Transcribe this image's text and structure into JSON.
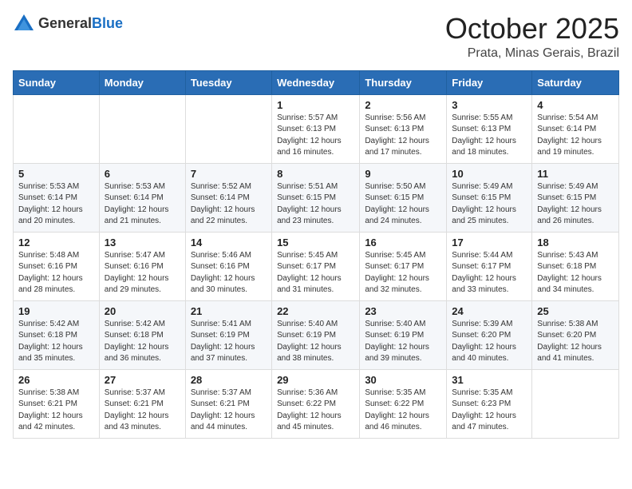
{
  "header": {
    "logo_general": "General",
    "logo_blue": "Blue",
    "month": "October 2025",
    "location": "Prata, Minas Gerais, Brazil"
  },
  "days_of_week": [
    "Sunday",
    "Monday",
    "Tuesday",
    "Wednesday",
    "Thursday",
    "Friday",
    "Saturday"
  ],
  "weeks": [
    [
      {
        "day": "",
        "info": ""
      },
      {
        "day": "",
        "info": ""
      },
      {
        "day": "",
        "info": ""
      },
      {
        "day": "1",
        "info": "Sunrise: 5:57 AM\nSunset: 6:13 PM\nDaylight: 12 hours\nand 16 minutes."
      },
      {
        "day": "2",
        "info": "Sunrise: 5:56 AM\nSunset: 6:13 PM\nDaylight: 12 hours\nand 17 minutes."
      },
      {
        "day": "3",
        "info": "Sunrise: 5:55 AM\nSunset: 6:13 PM\nDaylight: 12 hours\nand 18 minutes."
      },
      {
        "day": "4",
        "info": "Sunrise: 5:54 AM\nSunset: 6:14 PM\nDaylight: 12 hours\nand 19 minutes."
      }
    ],
    [
      {
        "day": "5",
        "info": "Sunrise: 5:53 AM\nSunset: 6:14 PM\nDaylight: 12 hours\nand 20 minutes."
      },
      {
        "day": "6",
        "info": "Sunrise: 5:53 AM\nSunset: 6:14 PM\nDaylight: 12 hours\nand 21 minutes."
      },
      {
        "day": "7",
        "info": "Sunrise: 5:52 AM\nSunset: 6:14 PM\nDaylight: 12 hours\nand 22 minutes."
      },
      {
        "day": "8",
        "info": "Sunrise: 5:51 AM\nSunset: 6:15 PM\nDaylight: 12 hours\nand 23 minutes."
      },
      {
        "day": "9",
        "info": "Sunrise: 5:50 AM\nSunset: 6:15 PM\nDaylight: 12 hours\nand 24 minutes."
      },
      {
        "day": "10",
        "info": "Sunrise: 5:49 AM\nSunset: 6:15 PM\nDaylight: 12 hours\nand 25 minutes."
      },
      {
        "day": "11",
        "info": "Sunrise: 5:49 AM\nSunset: 6:15 PM\nDaylight: 12 hours\nand 26 minutes."
      }
    ],
    [
      {
        "day": "12",
        "info": "Sunrise: 5:48 AM\nSunset: 6:16 PM\nDaylight: 12 hours\nand 28 minutes."
      },
      {
        "day": "13",
        "info": "Sunrise: 5:47 AM\nSunset: 6:16 PM\nDaylight: 12 hours\nand 29 minutes."
      },
      {
        "day": "14",
        "info": "Sunrise: 5:46 AM\nSunset: 6:16 PM\nDaylight: 12 hours\nand 30 minutes."
      },
      {
        "day": "15",
        "info": "Sunrise: 5:45 AM\nSunset: 6:17 PM\nDaylight: 12 hours\nand 31 minutes."
      },
      {
        "day": "16",
        "info": "Sunrise: 5:45 AM\nSunset: 6:17 PM\nDaylight: 12 hours\nand 32 minutes."
      },
      {
        "day": "17",
        "info": "Sunrise: 5:44 AM\nSunset: 6:17 PM\nDaylight: 12 hours\nand 33 minutes."
      },
      {
        "day": "18",
        "info": "Sunrise: 5:43 AM\nSunset: 6:18 PM\nDaylight: 12 hours\nand 34 minutes."
      }
    ],
    [
      {
        "day": "19",
        "info": "Sunrise: 5:42 AM\nSunset: 6:18 PM\nDaylight: 12 hours\nand 35 minutes."
      },
      {
        "day": "20",
        "info": "Sunrise: 5:42 AM\nSunset: 6:18 PM\nDaylight: 12 hours\nand 36 minutes."
      },
      {
        "day": "21",
        "info": "Sunrise: 5:41 AM\nSunset: 6:19 PM\nDaylight: 12 hours\nand 37 minutes."
      },
      {
        "day": "22",
        "info": "Sunrise: 5:40 AM\nSunset: 6:19 PM\nDaylight: 12 hours\nand 38 minutes."
      },
      {
        "day": "23",
        "info": "Sunrise: 5:40 AM\nSunset: 6:19 PM\nDaylight: 12 hours\nand 39 minutes."
      },
      {
        "day": "24",
        "info": "Sunrise: 5:39 AM\nSunset: 6:20 PM\nDaylight: 12 hours\nand 40 minutes."
      },
      {
        "day": "25",
        "info": "Sunrise: 5:38 AM\nSunset: 6:20 PM\nDaylight: 12 hours\nand 41 minutes."
      }
    ],
    [
      {
        "day": "26",
        "info": "Sunrise: 5:38 AM\nSunset: 6:21 PM\nDaylight: 12 hours\nand 42 minutes."
      },
      {
        "day": "27",
        "info": "Sunrise: 5:37 AM\nSunset: 6:21 PM\nDaylight: 12 hours\nand 43 minutes."
      },
      {
        "day": "28",
        "info": "Sunrise: 5:37 AM\nSunset: 6:21 PM\nDaylight: 12 hours\nand 44 minutes."
      },
      {
        "day": "29",
        "info": "Sunrise: 5:36 AM\nSunset: 6:22 PM\nDaylight: 12 hours\nand 45 minutes."
      },
      {
        "day": "30",
        "info": "Sunrise: 5:35 AM\nSunset: 6:22 PM\nDaylight: 12 hours\nand 46 minutes."
      },
      {
        "day": "31",
        "info": "Sunrise: 5:35 AM\nSunset: 6:23 PM\nDaylight: 12 hours\nand 47 minutes."
      },
      {
        "day": "",
        "info": ""
      }
    ]
  ]
}
